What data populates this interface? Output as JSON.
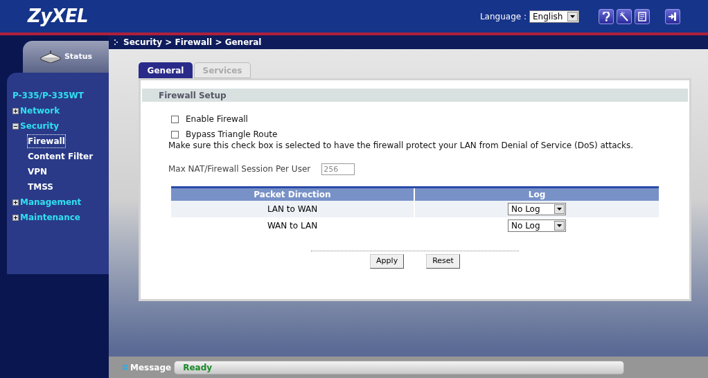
{
  "header": {
    "logo": "ZyXEL",
    "language_label": "Language :",
    "language": "English"
  },
  "breadcrumb": "Security > Firewall > General",
  "sidebar": {
    "status_tab": "Status",
    "device": "P-335/P-335WT",
    "items": [
      {
        "label": "Network",
        "expanded": false
      },
      {
        "label": "Security",
        "expanded": true,
        "children": [
          {
            "label": "Firewall",
            "selected": true
          },
          {
            "label": "Content Filter",
            "selected": false
          },
          {
            "label": "VPN",
            "selected": false
          },
          {
            "label": "TMSS",
            "selected": false
          }
        ]
      },
      {
        "label": "Management",
        "expanded": false
      },
      {
        "label": "Maintenance",
        "expanded": false
      }
    ]
  },
  "tabs": [
    {
      "label": "General",
      "selected": true
    },
    {
      "label": "Services",
      "selected": false
    }
  ],
  "section_title": "Firewall Setup",
  "checkboxes": [
    {
      "label": "Enable Firewall",
      "checked": false
    },
    {
      "label": "Bypass Triangle Route",
      "checked": false
    }
  ],
  "note": "Make sure this check box is selected to have the firewall protect your LAN from Denial of Service (DoS) attacks.",
  "session_field": {
    "label": "Max NAT/Firewall Session Per User",
    "value": "256",
    "disabled": true
  },
  "table": {
    "columns": [
      "Packet Direction",
      "Log"
    ],
    "rows": [
      {
        "direction": "LAN to WAN",
        "log": "No Log"
      },
      {
        "direction": "WAN to LAN",
        "log": "No Log"
      }
    ]
  },
  "buttons": [
    "Apply",
    "Reset"
  ],
  "status_bar": {
    "label": "Message",
    "value": "Ready"
  }
}
